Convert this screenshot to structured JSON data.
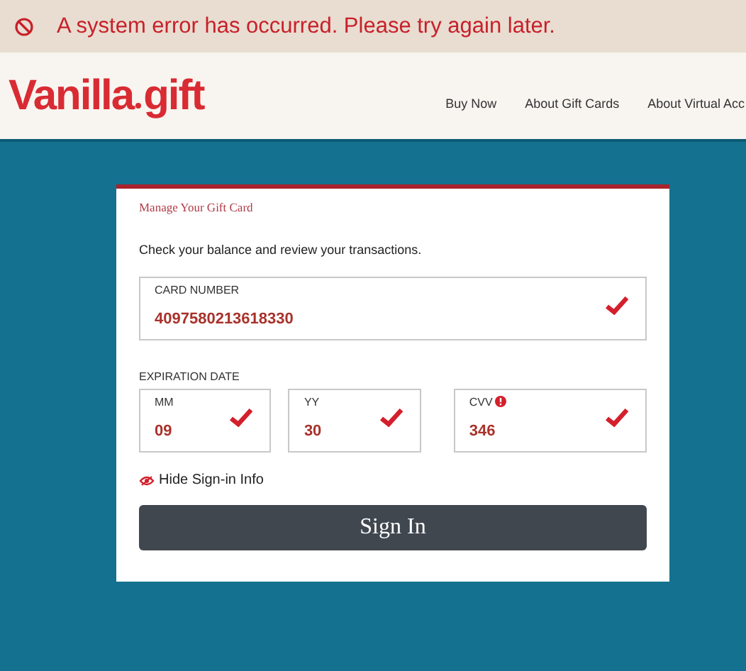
{
  "alert": {
    "message": "A system error has occurred. Please try again later."
  },
  "header": {
    "logo": {
      "brand": "Vanilla",
      "suffix": "gift"
    },
    "nav": [
      "Buy Now",
      "About Gift Cards",
      "About Virtual Acc"
    ]
  },
  "card": {
    "title": "Manage Your Gift Card",
    "intro": "Check your balance and review your transactions.",
    "card_number": {
      "label": "CARD NUMBER",
      "value": "4097580213618330",
      "valid": true
    },
    "expiration_label": "EXPIRATION DATE",
    "small_fields": [
      {
        "label": "MM",
        "value": "09",
        "valid": true,
        "info": false
      },
      {
        "label": "YY",
        "value": "30",
        "valid": true,
        "info": false
      },
      {
        "label": "CVV",
        "value": "346",
        "valid": true,
        "info": true
      }
    ],
    "toggle": "Hide Sign-in Info",
    "button": "Sign In"
  }
}
